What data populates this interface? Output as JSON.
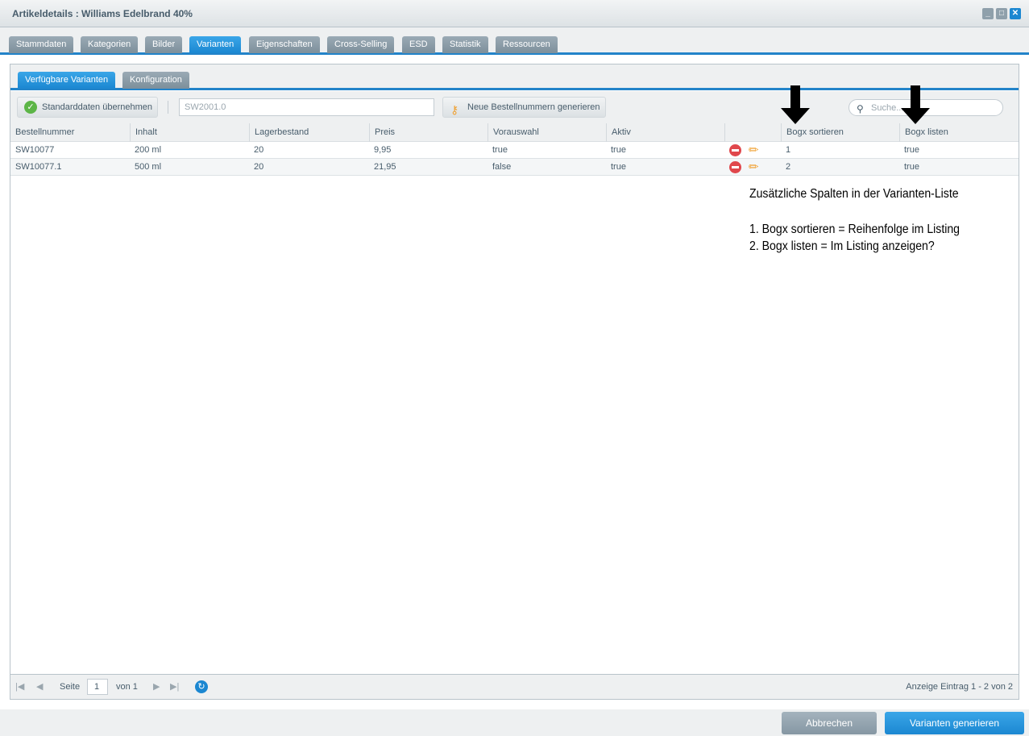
{
  "window": {
    "title": "Artikeldetails : Williams Edelbrand 40%"
  },
  "tabs": [
    "Stammdaten",
    "Kategorien",
    "Bilder",
    "Varianten",
    "Eigenschaften",
    "Cross-Selling",
    "ESD",
    "Statistik",
    "Ressourcen"
  ],
  "active_tab": "Varianten",
  "subtabs": [
    "Verfügbare Varianten",
    "Konfiguration"
  ],
  "toolbar": {
    "apply_defaults": "Standarddaten übernehmen",
    "number_value": "SW2001.0",
    "generate_numbers": "Neue Bestellnummern generieren",
    "search_placeholder": "Suche..."
  },
  "grid": {
    "columns": [
      "Bestellnummer",
      "Inhalt",
      "Lagerbestand",
      "Preis",
      "Vorauswahl",
      "Aktiv",
      "",
      "Bogx sortieren",
      "Bogx listen"
    ],
    "rows": [
      [
        "SW10077",
        "200 ml",
        "20",
        "9,95",
        "true",
        "true",
        "",
        "1",
        "true"
      ],
      [
        "SW10077.1",
        "500 ml",
        "20",
        "21,95",
        "false",
        "true",
        "",
        "2",
        "true"
      ]
    ]
  },
  "annotation": {
    "heading": "Zusätzliche Spalten in der Varianten-Liste",
    "line1": "1. Bogx sortieren = Reihenfolge im Listing",
    "line2": "2. Bogx listen = Im Listing anzeigen?"
  },
  "pager": {
    "page_label": "Seite",
    "page": "1",
    "of_label": "von 1",
    "summary": "Anzeige Eintrag 1 - 2 von 2"
  },
  "footer": {
    "cancel": "Abbrechen",
    "generate": "Varianten generieren"
  },
  "colors": {
    "accent": "#2283c9",
    "delete": "#e0474c",
    "edit": "#f0a030"
  }
}
